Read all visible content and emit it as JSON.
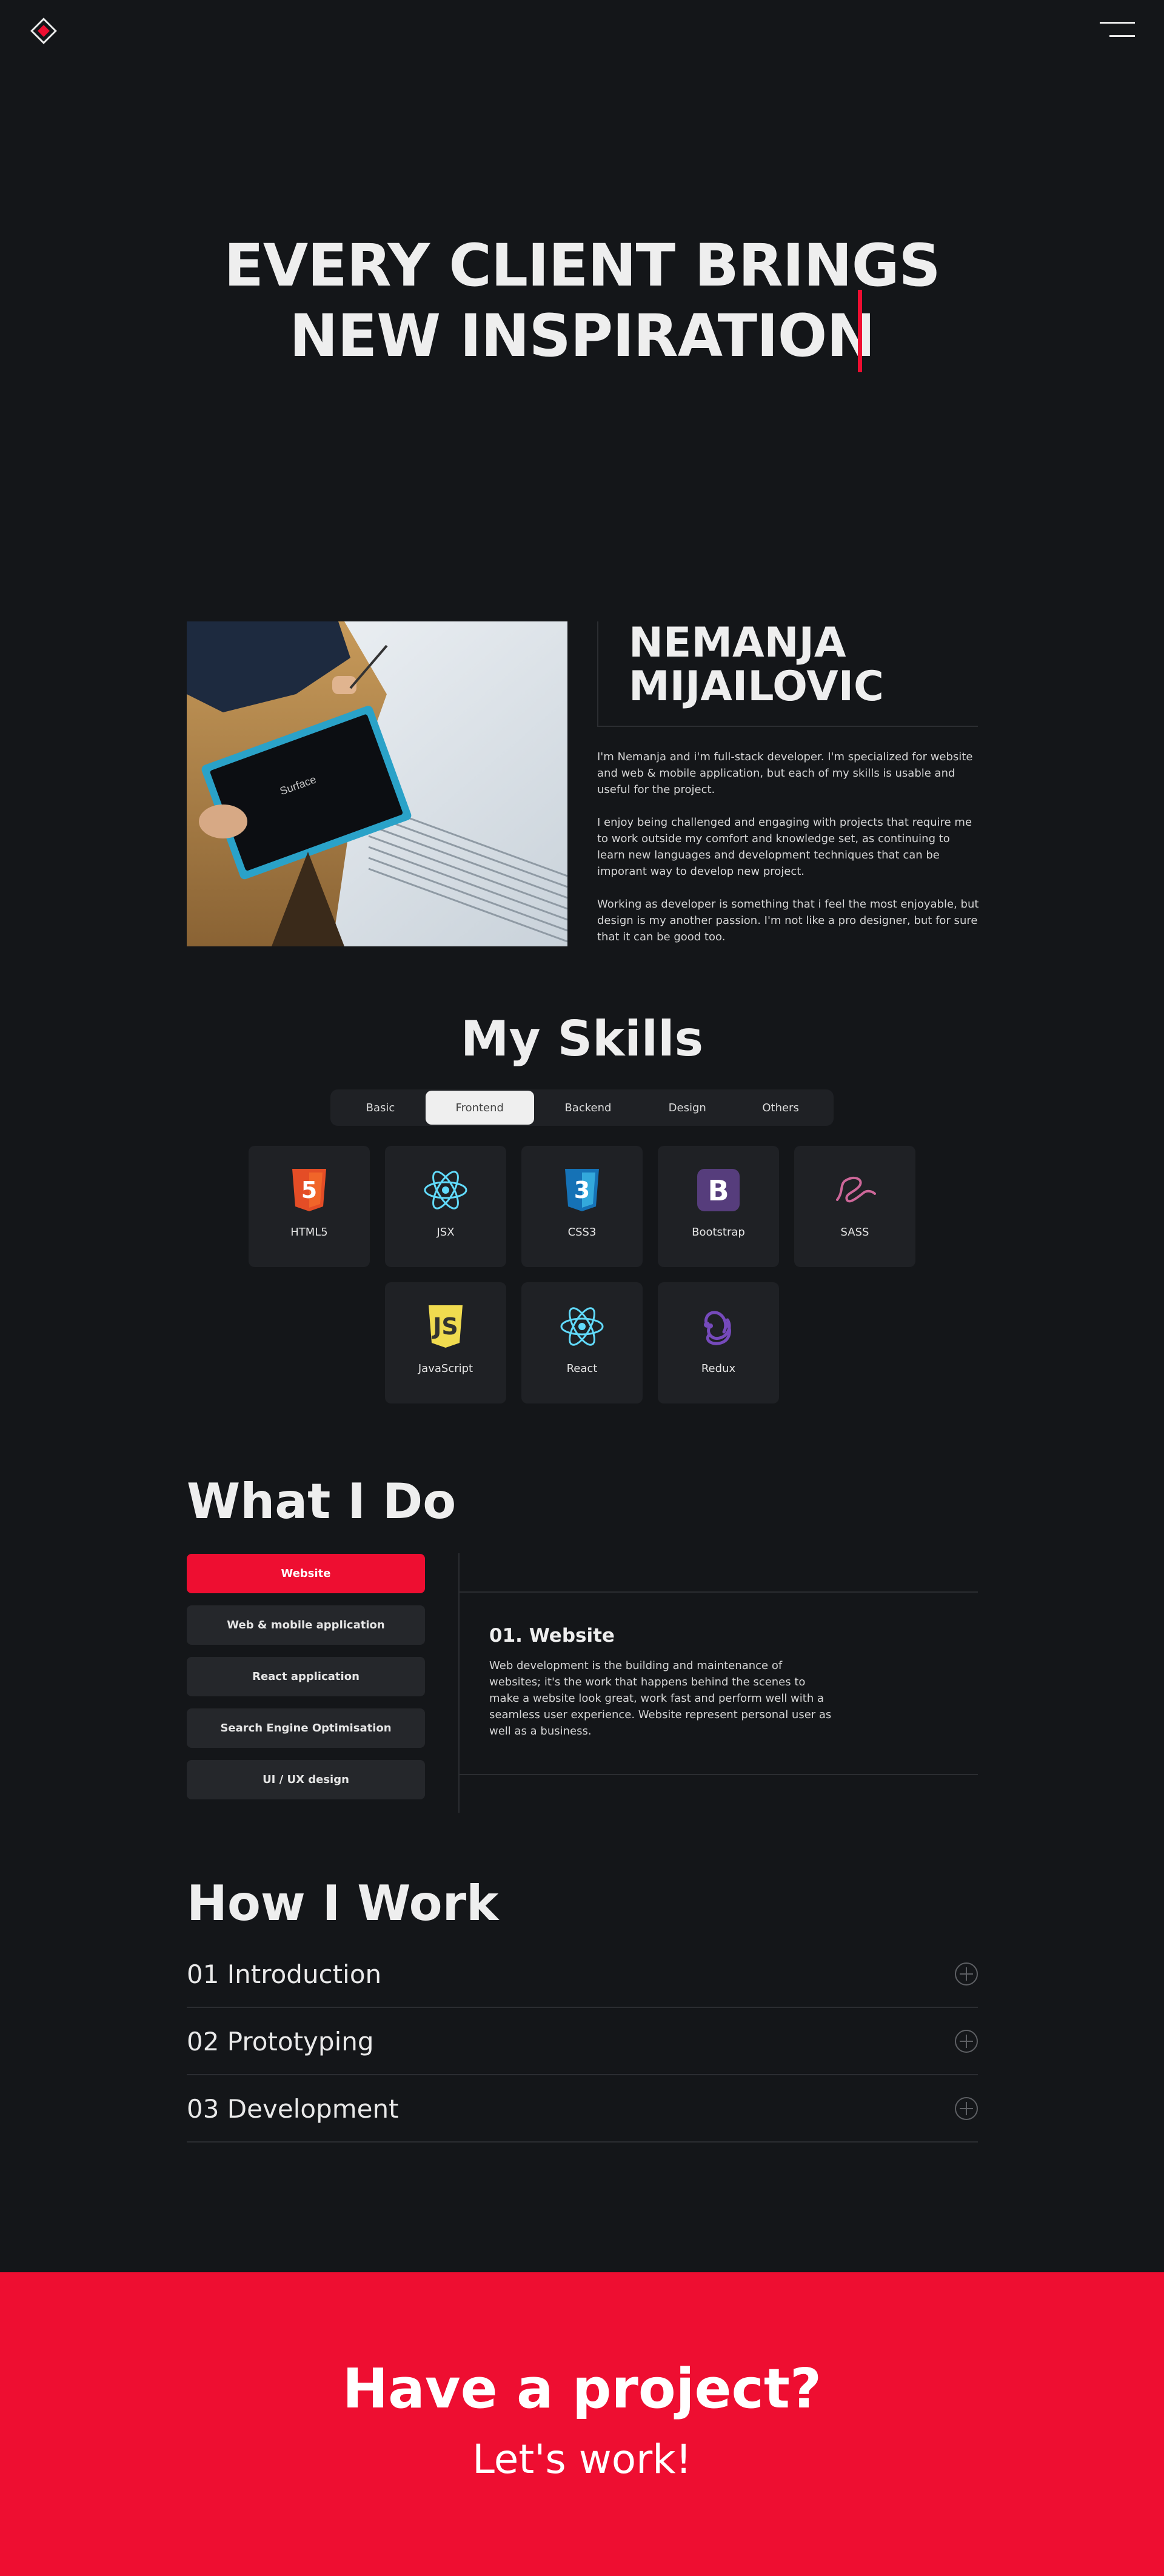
{
  "header": {
    "logo_icon": "diamond-logo-icon",
    "menu_icon": "hamburger-menu-icon"
  },
  "hero": {
    "line1": "EVERY CLIENT BRINGS",
    "line2": "NEW INSPIRATION"
  },
  "about": {
    "image_description_icon": "photo-person-with-tablet",
    "name_line1": "NEMANJA",
    "name_line2": "MIJAILOVIC",
    "paragraphs": [
      "I'm Nemanja and i'm full-stack developer. I'm specialized for website and web & mobile application, but each of my skills is usable and useful for the project.",
      "I enjoy being challenged and engaging with projects that require me to work outside my comfort and knowledge set, as continuing to learn new languages and development techniques that can be imporant way to develop new project.",
      "Working as developer is something that i feel the most enjoyable, but design is my another passion. I'm not like a pro designer, but for sure that it can be good too."
    ]
  },
  "skills": {
    "title": "My Skills",
    "tabs": [
      "Basic",
      "Frontend",
      "Backend",
      "Design",
      "Others"
    ],
    "active_tab": "Frontend",
    "items": [
      {
        "label": "HTML5",
        "icon": "html5-icon",
        "color": "#e44d26"
      },
      {
        "label": "JSX",
        "icon": "react-atom-icon",
        "color": "#61dafb"
      },
      {
        "label": "CSS3",
        "icon": "css3-icon",
        "color": "#1572b6"
      },
      {
        "label": "Bootstrap",
        "icon": "bootstrap-icon",
        "color": "#563d7c"
      },
      {
        "label": "SASS",
        "icon": "sass-icon",
        "color": "#cd6799"
      },
      {
        "label": "JavaScript",
        "icon": "javascript-icon",
        "color": "#f0db4f"
      },
      {
        "label": "React",
        "icon": "react-atom-icon",
        "color": "#61dafb"
      },
      {
        "label": "Redux",
        "icon": "redux-icon",
        "color": "#764abc"
      }
    ]
  },
  "what_i_do": {
    "title": "What I Do",
    "services": [
      "Website",
      "Web & mobile application",
      "React application",
      "Search Engine Optimisation",
      "UI / UX design"
    ],
    "active_service": "Website",
    "detail": {
      "heading": "01. Website",
      "text": "Web development is the building and maintenance of websites; it's the work that happens behind the scenes to make a website look great, work fast and perform well with a seamless user experience. Website represent personal user as well as a business."
    }
  },
  "how_i_work": {
    "title": "How I Work",
    "steps": [
      "01 Introduction",
      "02 Prototyping",
      "03 Development"
    ]
  },
  "cta": {
    "title": "Have a project?",
    "subtitle": "Let's work!"
  },
  "colors": {
    "background": "#141619",
    "accent": "#ee0e31",
    "card": "#1f2125"
  }
}
